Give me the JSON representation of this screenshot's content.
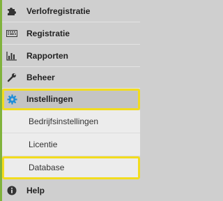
{
  "menu": {
    "items": [
      {
        "label": "Verlofregistratie",
        "icon": "puzzle-icon"
      },
      {
        "label": "Registratie",
        "icon": "keyboard-icon"
      },
      {
        "label": "Rapporten",
        "icon": "bar-chart-icon"
      },
      {
        "label": "Beheer",
        "icon": "wrench-icon"
      },
      {
        "label": "Instellingen",
        "icon": "gear-icon"
      }
    ],
    "subitems": [
      {
        "label": "Bedrijfsinstellingen"
      },
      {
        "label": "Licentie"
      },
      {
        "label": "Database"
      }
    ],
    "help": {
      "label": "Help",
      "icon": "info-icon"
    }
  },
  "colors": {
    "accent": "#80b33c",
    "highlight": "#f2dc1e",
    "gear_icon": "#1f8ed8"
  }
}
